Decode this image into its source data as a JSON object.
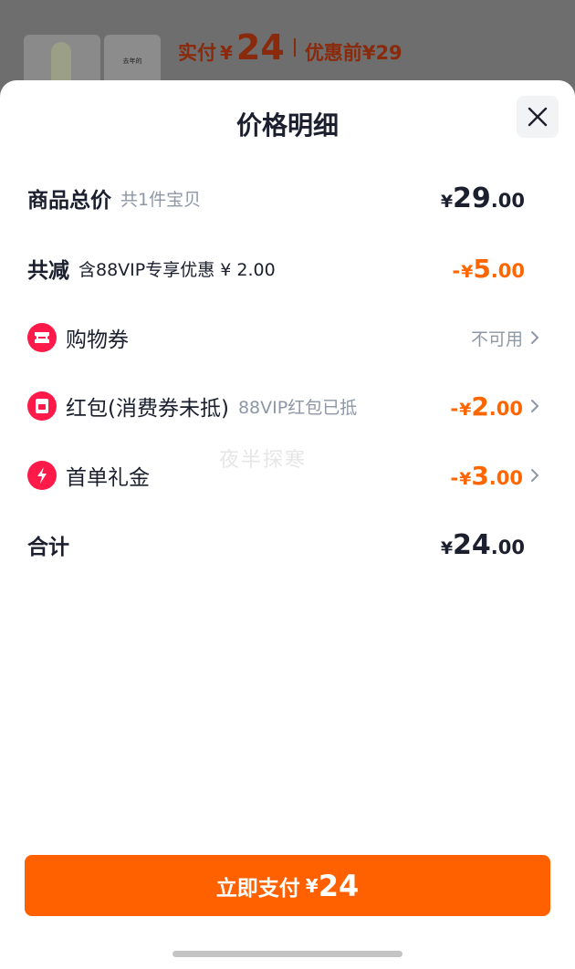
{
  "background": {
    "paid_label": "实付",
    "paid_currency": "¥",
    "paid_amount": "24",
    "original_label": "优惠前",
    "original_currency": "¥",
    "original_amount": "29",
    "thumb_text": "去年的"
  },
  "sheet": {
    "title": "价格明细",
    "close_icon": "close-icon"
  },
  "rows": {
    "subtotal": {
      "label": "商品总价",
      "sub": "共1件宝贝",
      "currency": "¥",
      "int": "29",
      "dec": ".00"
    },
    "discount": {
      "label": "共减",
      "sub": "含88VIP专享优惠 ¥ 2.00",
      "minus": "-",
      "currency": "¥",
      "int": "5",
      "dec": ".00"
    },
    "coupon": {
      "label": "购物券",
      "status": "不可用",
      "icon": "ticket-icon"
    },
    "redpacket": {
      "label": "红包(消费券未抵)",
      "sub": "88VIP红包已抵",
      "minus": "-",
      "currency": "¥",
      "int": "2",
      "dec": ".00",
      "icon": "red-packet-icon"
    },
    "first_order": {
      "label": "首单礼金",
      "minus": "-",
      "currency": "¥",
      "int": "3",
      "dec": ".00",
      "icon": "lightning-icon"
    },
    "total": {
      "label": "合计",
      "currency": "¥",
      "int": "24",
      "dec": ".00"
    }
  },
  "watermark": "夜半探寒",
  "pay_button": {
    "label": "立即支付",
    "currency": "¥",
    "amount": "24"
  },
  "colors": {
    "accent": "#ff6100",
    "discount": "#ff6600",
    "icon_red": "#ff1a4a",
    "text": "#1b1f2e",
    "muted": "#8e97a6"
  }
}
